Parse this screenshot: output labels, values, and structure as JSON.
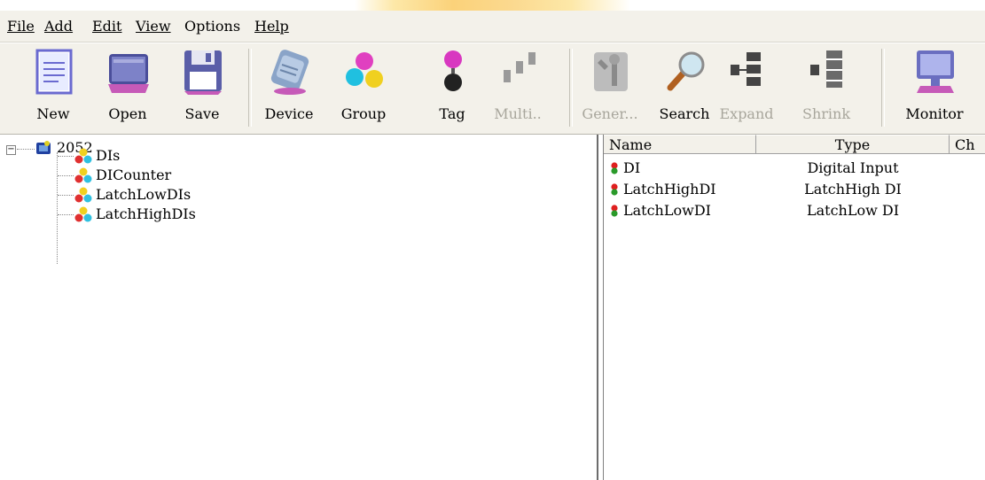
{
  "menu": {
    "file": "File",
    "add": "Add",
    "edit": "Edit",
    "view": "View",
    "options": "Options",
    "help": "Help"
  },
  "toolbar": {
    "new": "New",
    "open": "Open",
    "save": "Save",
    "device": "Device",
    "group": "Group",
    "tag": "Tag",
    "multi": "Multi..",
    "gener": "Gener...",
    "search": "Search",
    "expand": "Expand",
    "shrink": "Shrink",
    "monitor": "Monitor"
  },
  "tree": {
    "root": "2052",
    "expander": "−",
    "groups": [
      "DIs",
      "DICounter",
      "LatchLowDIs",
      "LatchHighDIs"
    ]
  },
  "list": {
    "columns": [
      "Name",
      "Type",
      "Ch"
    ],
    "rows": [
      {
        "name": "DI",
        "type": "Digital Input"
      },
      {
        "name": "LatchHighDI",
        "type": "LatchHigh DI"
      },
      {
        "name": "LatchLowDI",
        "type": "LatchLow DI"
      }
    ]
  },
  "colors": {
    "chrome": "#f3f1ea",
    "disabled_text": "#a8a69c",
    "tag_red": "#e02020",
    "tag_green": "#2a9a2a"
  },
  "icons": {
    "new": "document-icon",
    "open": "folder-icon",
    "save": "floppy-icon",
    "device": "device-module-icon",
    "group": "group-balls-icon",
    "tag": "tag-balls-icon",
    "multi": "multi-tag-icon",
    "gener": "tools-icon",
    "search": "magnifier-icon",
    "expand": "expand-tree-icon",
    "shrink": "shrink-tree-icon",
    "monitor": "monitor-icon"
  }
}
